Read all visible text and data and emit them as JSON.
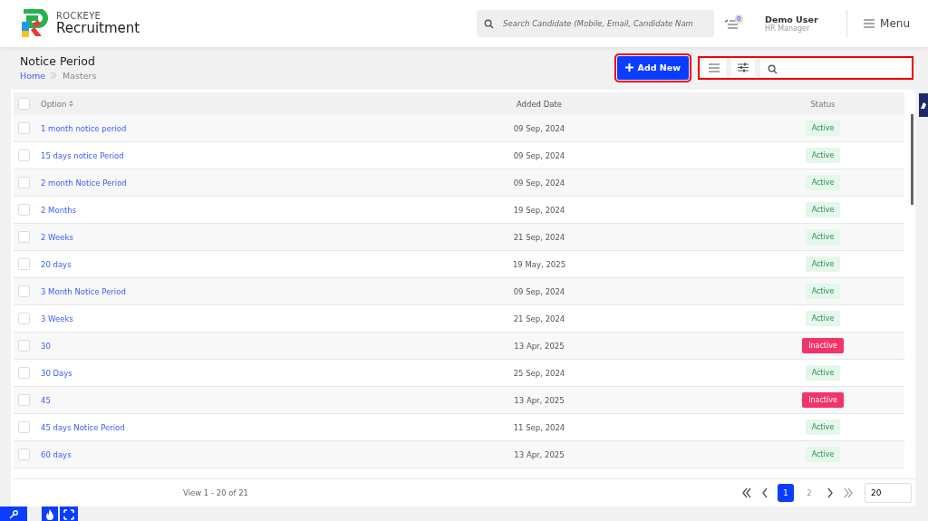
{
  "brand": {
    "small": "ROCKEYE",
    "large": "Recruitment"
  },
  "header": {
    "search_placeholder": "Search Candidate (Mobile, Email, Candidate Nam",
    "task_count": "0",
    "user_name": "Demo User",
    "user_role": "HR Manager",
    "menu_label": "Menu"
  },
  "page": {
    "title": "Notice Period",
    "breadcrumb": [
      "Home",
      "Masters"
    ],
    "add_button": "Add New"
  },
  "table": {
    "columns": [
      "Option",
      "Added Date",
      "Status"
    ],
    "all_checked": false,
    "rows": [
      {
        "checked": false,
        "option": "1 month notice period",
        "date": "09 Sep, 2024",
        "status": "Active",
        "active": true
      },
      {
        "checked": false,
        "option": "15 days notice Period",
        "date": "09 Sep, 2024",
        "status": "Active",
        "active": true
      },
      {
        "checked": false,
        "option": "2 month Notice Period",
        "date": "09 Sep, 2024",
        "status": "Active",
        "active": true
      },
      {
        "checked": false,
        "option": "2 Months",
        "date": "19 Sep, 2024",
        "status": "Active",
        "active": true
      },
      {
        "checked": false,
        "option": "2 Weeks",
        "date": "21 Sep, 2024",
        "status": "Active",
        "active": true
      },
      {
        "checked": false,
        "option": "20 days",
        "date": "19 May, 2025",
        "status": "Active",
        "active": true
      },
      {
        "checked": false,
        "option": "3 Month Notice Period",
        "date": "09 Sep, 2024",
        "status": "Active",
        "active": true
      },
      {
        "checked": false,
        "option": "3 Weeks",
        "date": "21 Sep, 2024",
        "status": "Active",
        "active": true
      },
      {
        "checked": false,
        "option": "30",
        "date": "13 Apr, 2025",
        "status": "Inactive",
        "active": false
      },
      {
        "checked": false,
        "option": "30 Days",
        "date": "25 Sep, 2024",
        "status": "Active",
        "active": true
      },
      {
        "checked": false,
        "option": "45",
        "date": "13 Apr, 2025",
        "status": "Inactive",
        "active": false
      },
      {
        "checked": false,
        "option": "45 days Notice Period",
        "date": "11 Sep, 2024",
        "status": "Active",
        "active": true
      },
      {
        "checked": false,
        "option": "60 days",
        "date": "13 Apr, 2025",
        "status": "Active",
        "active": true
      }
    ]
  },
  "pager": {
    "summary": "View 1 - 20 of 21",
    "pages": [
      {
        "label": "1",
        "selected": true
      },
      {
        "label": "2",
        "selected": false
      }
    ],
    "page_size": "20"
  }
}
